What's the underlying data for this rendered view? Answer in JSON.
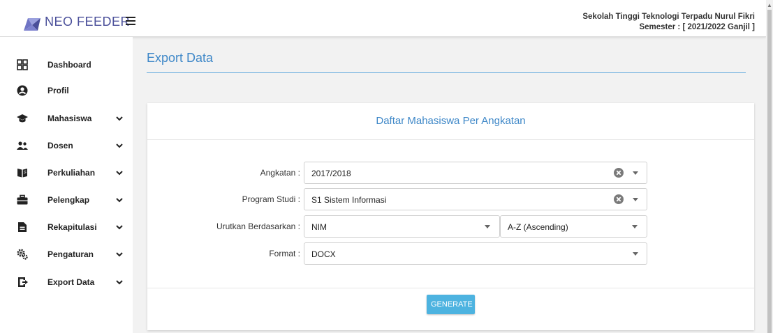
{
  "header": {
    "brand": "NEO FEEDER",
    "institution": "Sekolah Tinggi Teknologi Terpadu Nurul Fikri",
    "semester": "Semester : [ 2021/2022 Ganjil ]"
  },
  "sidebar": {
    "items": [
      {
        "label": "Dashboard",
        "icon": "grid-icon"
      },
      {
        "label": "Profil",
        "icon": "user-circle-icon"
      },
      {
        "label": "Mahasiswa",
        "icon": "graduation-cap-icon"
      },
      {
        "label": "Dosen",
        "icon": "users-icon"
      },
      {
        "label": "Perkuliahan",
        "icon": "book-open-icon"
      },
      {
        "label": "Pelengkap",
        "icon": "toolbox-icon"
      },
      {
        "label": "Rekapitulasi",
        "icon": "file-icon"
      },
      {
        "label": "Pengaturan",
        "icon": "cogs-icon"
      },
      {
        "label": "Export Data",
        "icon": "export-icon"
      }
    ]
  },
  "page": {
    "title": "Export Data",
    "card_title": "Daftar Mahasiswa Per Angkatan"
  },
  "form": {
    "angkatan": {
      "label": "Angkatan :",
      "value": "2017/2018"
    },
    "prodi": {
      "label": "Program Studi :",
      "value": "S1 Sistem Informasi"
    },
    "urutkan": {
      "label": "Urutkan Berdasarkan :",
      "field": "NIM",
      "order": "A-Z (Ascending)"
    },
    "format": {
      "label": "Format :",
      "value": "DOCX"
    }
  },
  "actions": {
    "generate": "GENERATE"
  },
  "colors": {
    "accent": "#3f88c8",
    "button": "#4db3e0",
    "brand": "#4a4f9a"
  }
}
